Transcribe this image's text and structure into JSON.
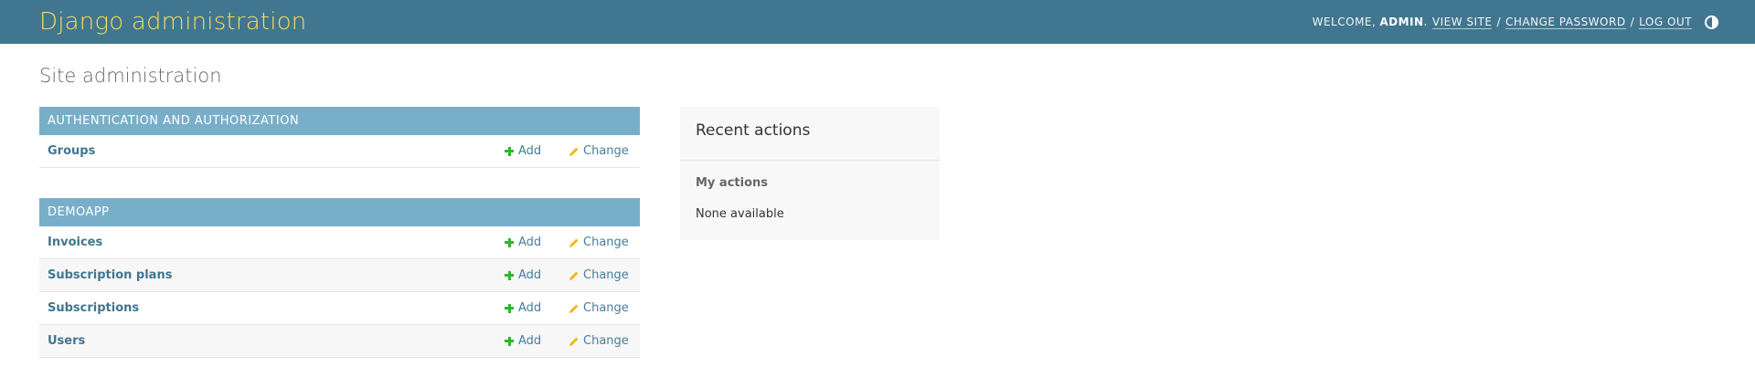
{
  "header": {
    "brand": "Django administration",
    "welcome": "Welcome,",
    "username": "ADMIN",
    "view_site": "View site",
    "change_password": "Change password",
    "log_out": "Log out",
    "theme_icon": "theme-toggle-icon"
  },
  "page": {
    "title": "Site administration"
  },
  "modules": [
    {
      "caption": "Authentication and Authorization",
      "models": [
        {
          "name": "Groups",
          "add": "Add",
          "change": "Change"
        }
      ]
    },
    {
      "caption": "Demoapp",
      "models": [
        {
          "name": "Invoices",
          "add": "Add",
          "change": "Change"
        },
        {
          "name": "Subscription plans",
          "add": "Add",
          "change": "Change"
        },
        {
          "name": "Subscriptions",
          "add": "Add",
          "change": "Change"
        },
        {
          "name": "Users",
          "add": "Add",
          "change": "Change"
        }
      ]
    }
  ],
  "recent_actions": {
    "title": "Recent actions",
    "subtitle": "My actions",
    "empty": "None available"
  },
  "colors": {
    "header_bg": "#417690",
    "brand": "#f5dd5d",
    "module_caption_bg": "#79aec8",
    "link": "#417690",
    "add_icon": "#2fb62f",
    "change_icon": "#efb80b"
  }
}
